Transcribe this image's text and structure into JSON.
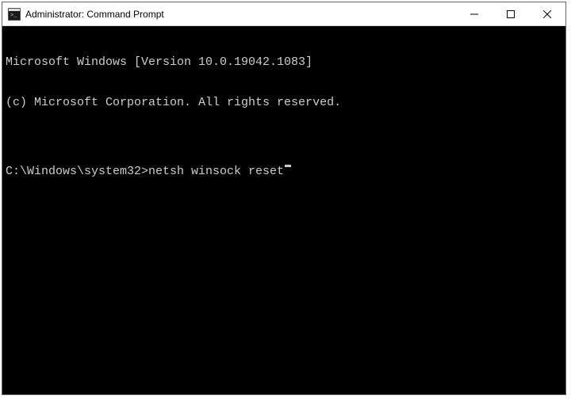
{
  "window": {
    "title": "Administrator: Command Prompt"
  },
  "terminal": {
    "line1": "Microsoft Windows [Version 10.0.19042.1083]",
    "line2": "(c) Microsoft Corporation. All rights reserved.",
    "blank": "",
    "prompt": "C:\\Windows\\system32>",
    "command": "netsh winsock reset"
  }
}
